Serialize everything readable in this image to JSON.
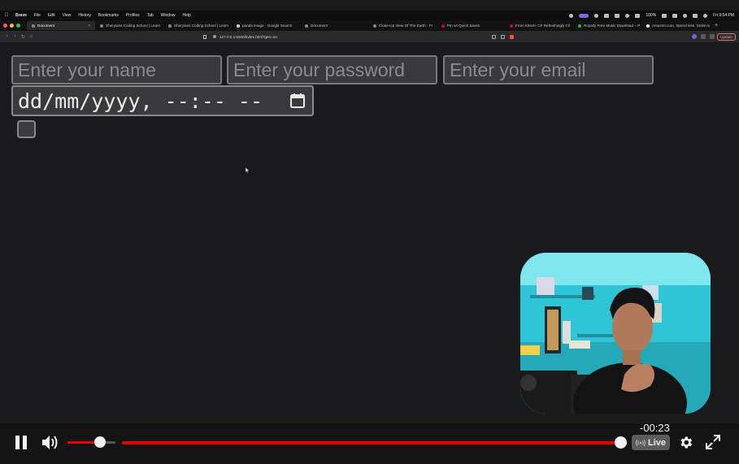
{
  "menubar": {
    "items": [
      "Brave",
      "File",
      "Edit",
      "View",
      "History",
      "Bookmarks",
      "Profiles",
      "Tab",
      "Window",
      "Help"
    ],
    "battery": "100%",
    "clock": "Fri 9:54 PM"
  },
  "tabs": [
    {
      "label": "Document",
      "active": true
    },
    {
      "label": "Sheryians Coding School | Learn",
      "active": false
    },
    {
      "label": "Sheryians Coding School | Learn",
      "active": false
    },
    {
      "label": "panda image - Google Search",
      "active": false
    },
    {
      "label": "Document",
      "active": false
    },
    {
      "label": "Close-Up View Of The Earth · Fr",
      "active": false
    },
    {
      "label": "Pin on Quick Saves",
      "active": false
    },
    {
      "label": "From Kitsch- CF Refreshingly Cli",
      "active": false
    },
    {
      "label": "Royalty Free Music Download – P",
      "active": false
    },
    {
      "label": "Amazon.com. Spend less. Smile m",
      "active": false
    }
  ],
  "urlbar": {
    "url": "127.0.0.1:5500/index.html?gen=on",
    "update_label": "Update"
  },
  "form": {
    "name_placeholder": "Enter your name",
    "password_placeholder": "Enter your password",
    "email_placeholder": "Enter your email",
    "datetime_text": "dd/mm/yyyy, --:-- --",
    "checkbox_checked": false
  },
  "player": {
    "time_remaining": "-00:23",
    "live_label": "Live",
    "volume_level": 0.68,
    "progress": 0.99,
    "accent_color": "#e10600"
  },
  "icons": [
    "apple-icon",
    "calendar-icon",
    "pause-icon",
    "volume-icon",
    "live-signal-icon",
    "gear-icon",
    "fullscreen-icon"
  ]
}
